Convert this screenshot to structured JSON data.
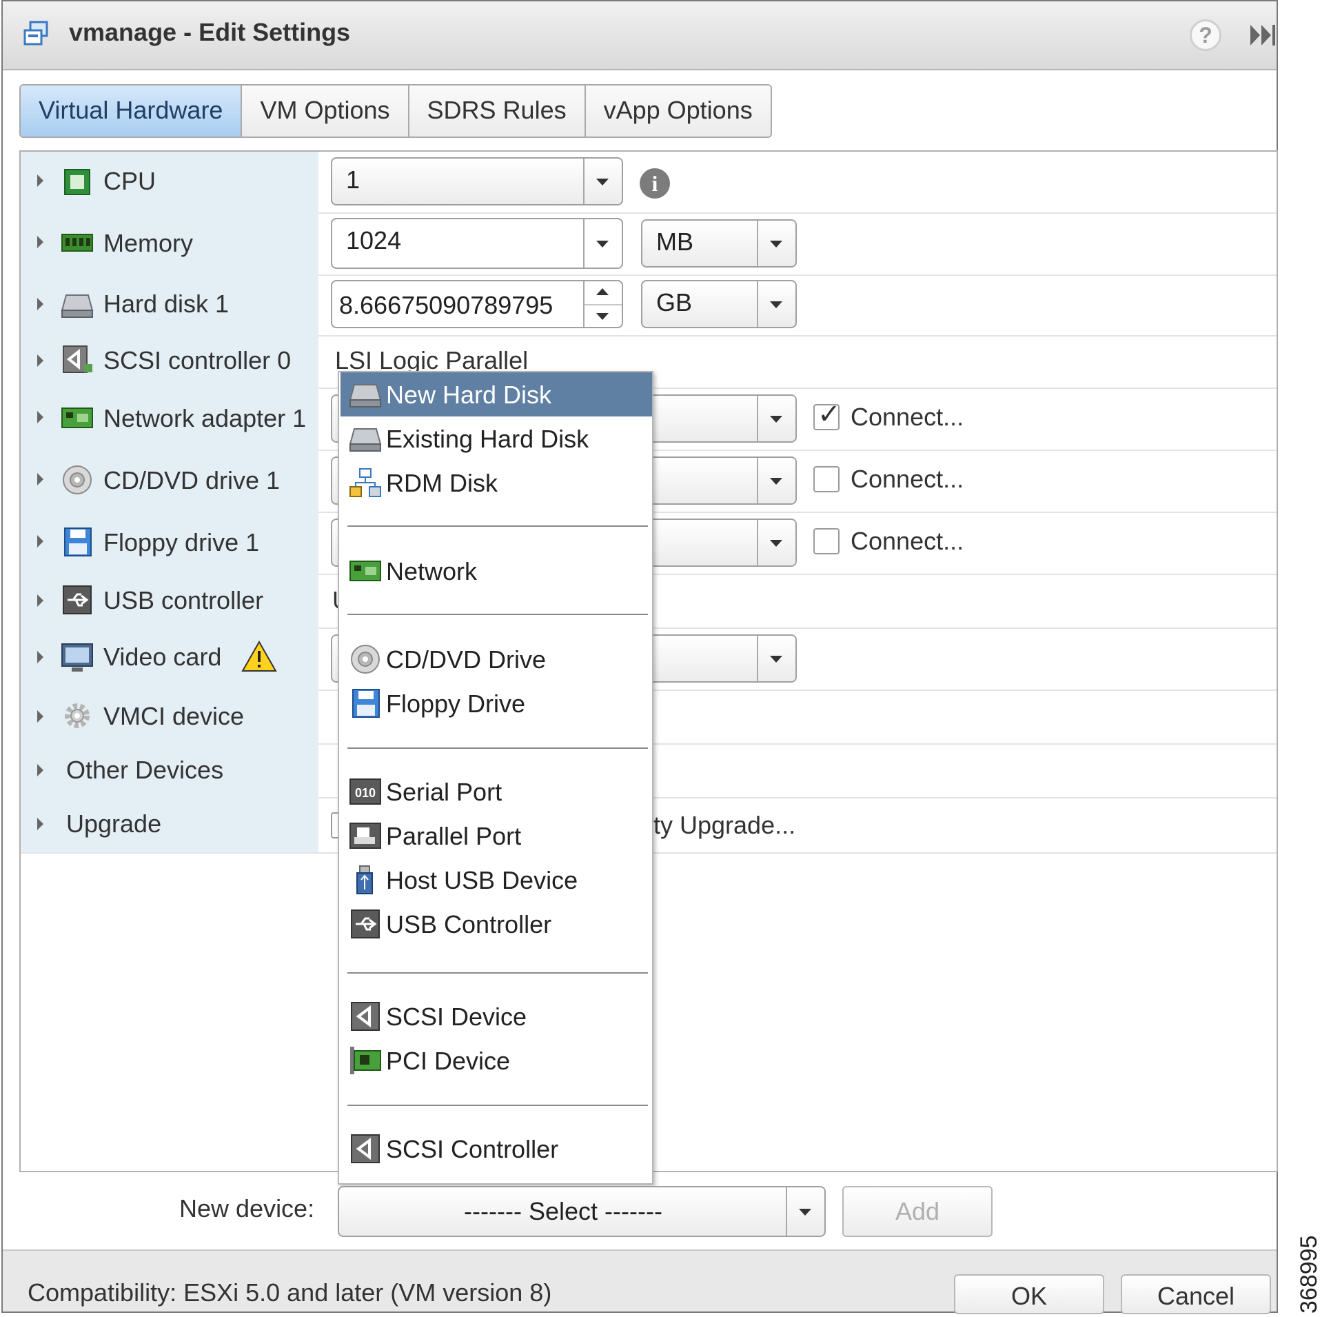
{
  "window": {
    "title": "vmanage - Edit Settings"
  },
  "tabs": [
    {
      "label": "Virtual Hardware",
      "active": true
    },
    {
      "label": "VM Options"
    },
    {
      "label": "SDRS Rules"
    },
    {
      "label": "vApp Options"
    }
  ],
  "hardware": {
    "cpu": {
      "label": "CPU",
      "value": "1"
    },
    "memory": {
      "label": "Memory",
      "value": "1024",
      "unit": "MB"
    },
    "hard_disk": {
      "label": "Hard disk 1",
      "value": "8.66675090789795",
      "unit": "GB"
    },
    "scsi": {
      "label": "SCSI controller 0",
      "value": "LSI Logic Parallel"
    },
    "network": {
      "label": "Network adapter 1",
      "connect": "Connect...",
      "connected": true
    },
    "cdvd": {
      "label": "CD/DVD drive 1",
      "connect": "Connect...",
      "connected": false
    },
    "floppy": {
      "label": "Floppy drive 1",
      "connect": "Connect...",
      "connected": false
    },
    "usb": {
      "label": "USB controller",
      "value": "U"
    },
    "video": {
      "label": "Video card"
    },
    "vmci": {
      "label": "VMCI device"
    },
    "other": {
      "label": "Other Devices"
    },
    "upgrade": {
      "label": "Upgrade",
      "value": "ty Upgrade..."
    }
  },
  "new_device_menu": {
    "items": [
      {
        "label": "New Hard Disk",
        "icon": "hard-disk-icon",
        "selected": true
      },
      {
        "label": "Existing Hard Disk",
        "icon": "hard-disk-icon"
      },
      {
        "label": "RDM Disk",
        "icon": "rdm-disk-icon"
      },
      {
        "label": "Network",
        "icon": "network-card-icon"
      },
      {
        "label": "CD/DVD Drive",
        "icon": "cd-icon"
      },
      {
        "label": "Floppy Drive",
        "icon": "floppy-icon"
      },
      {
        "label": "Serial Port",
        "icon": "serial-port-icon"
      },
      {
        "label": "Parallel Port",
        "icon": "parallel-port-icon"
      },
      {
        "label": "Host USB Device",
        "icon": "usb-stick-icon"
      },
      {
        "label": "USB Controller",
        "icon": "usb-icon"
      },
      {
        "label": "SCSI Device",
        "icon": "scsi-icon"
      },
      {
        "label": "PCI Device",
        "icon": "pci-card-icon"
      },
      {
        "label": "SCSI Controller",
        "icon": "scsi-icon"
      }
    ]
  },
  "new_device": {
    "label": "New device:",
    "select": "------- Select -------",
    "add": "Add"
  },
  "footer": {
    "compatibility": "Compatibility: ESXi 5.0 and later (VM version 8)",
    "ok": "OK",
    "cancel": "Cancel"
  },
  "figure_id": "368995",
  "colors": {
    "selected_tab": "#a9cdf1",
    "menu_highlight": "#5f7fa3",
    "label_column": "#e4eef5"
  }
}
